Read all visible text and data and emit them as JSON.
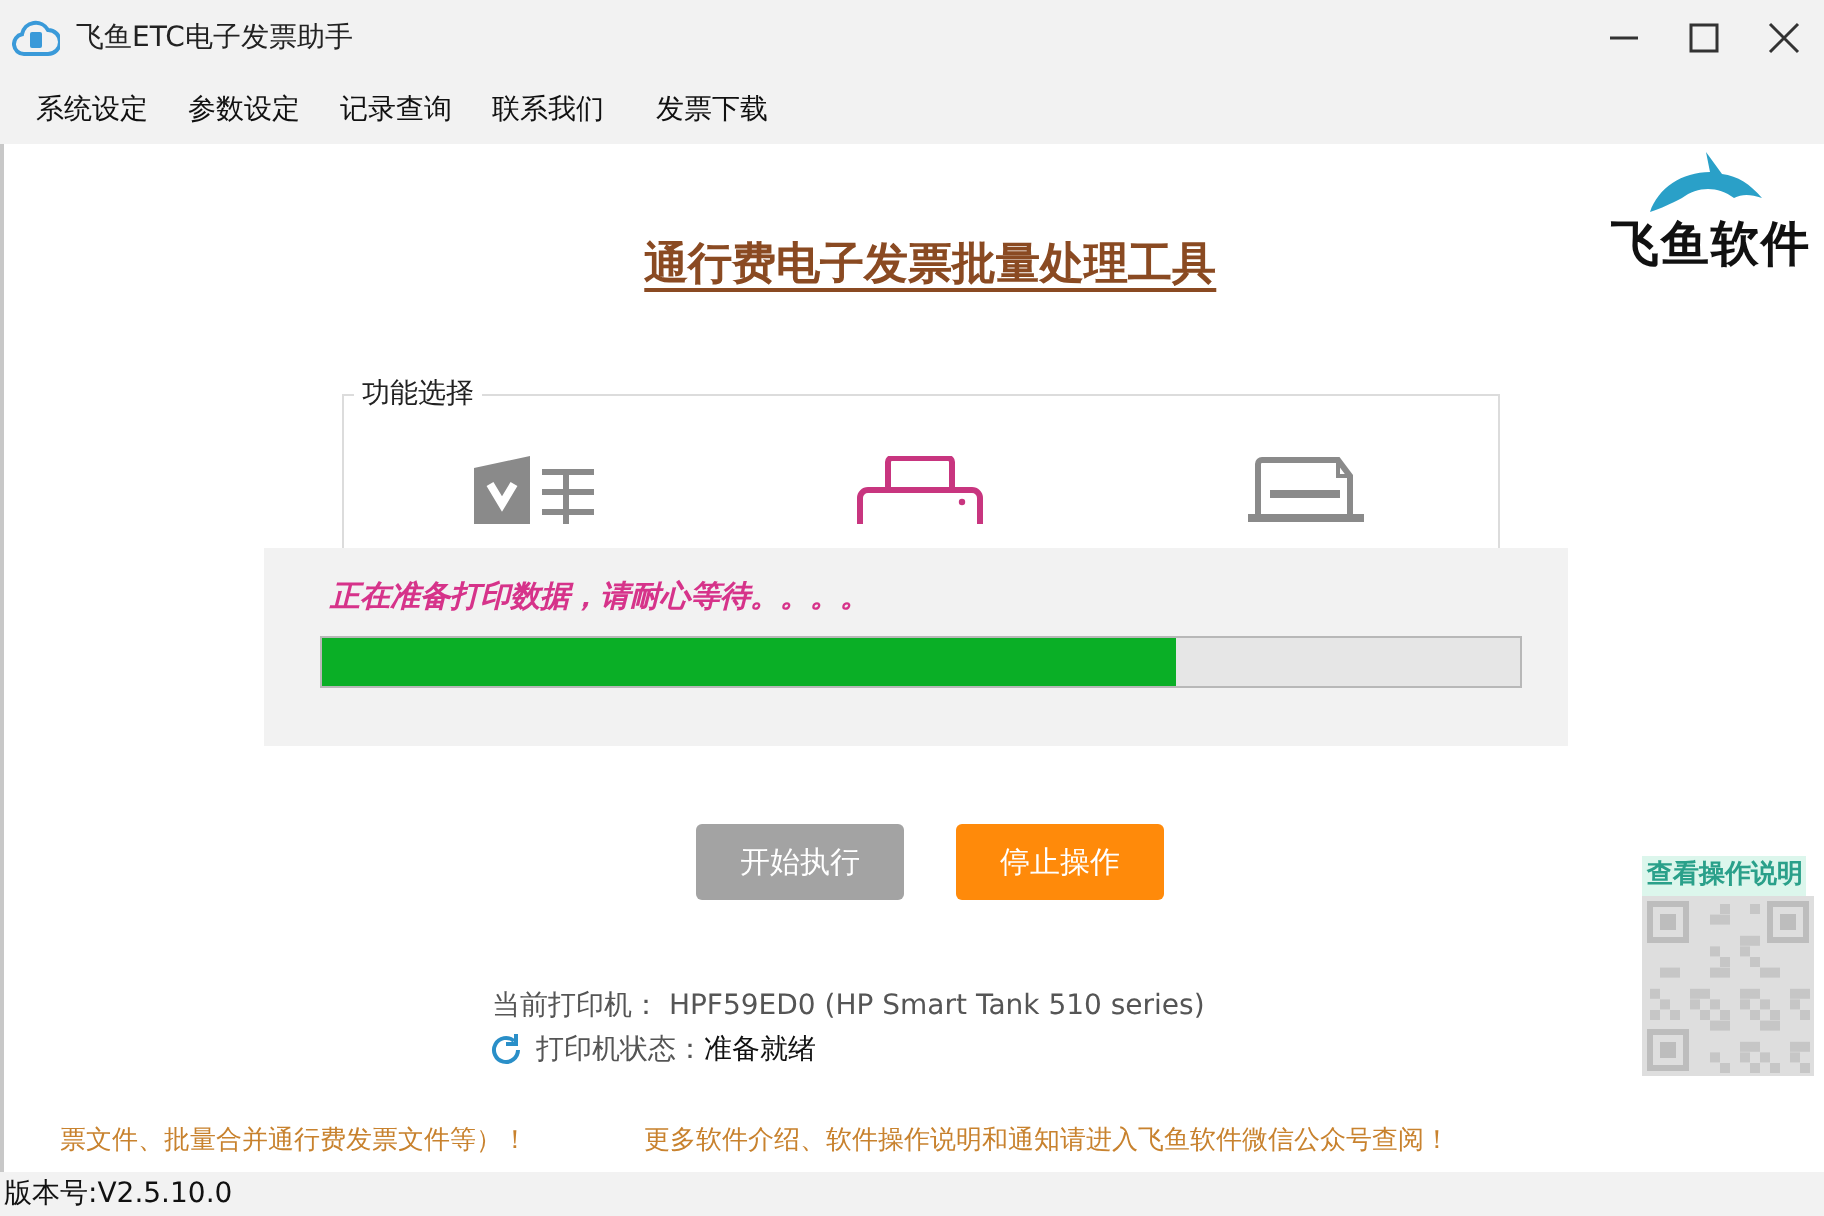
{
  "window": {
    "title": "飞鱼ETC电子发票助手"
  },
  "menu": [
    "系统设定",
    "参数设定",
    "记录查询",
    "联系我们",
    "发票下载"
  ],
  "heading": "通行费电子发票批量处理工具",
  "logo": {
    "text": "飞鱼软件"
  },
  "function_group": {
    "legend": "功能选择"
  },
  "progress": {
    "message": "正在准备打印数据，请耐心等待。。。。",
    "level": 0.713
  },
  "buttons": [
    {
      "label": "开始执行",
      "kind": "start",
      "disabled": true
    },
    {
      "label": "停止操作",
      "kind": "stop",
      "disabled": false
    }
  ],
  "printer": {
    "label": "当前打印机：",
    "value": "HPF59ED0 (HP Smart Tank 510 series)",
    "status_label": "打印机状态：",
    "status_value": "准备就绪"
  },
  "help": {
    "title": "查看操作说明"
  },
  "marquee": [
    "票文件、批量合并通行费发票文件等）！",
    "更多软件介绍、软件操作说明和通知请进入飞鱼软件微信公众号查阅！"
  ],
  "status_bar": {
    "version": "版本号:V2.5.10.0"
  }
}
